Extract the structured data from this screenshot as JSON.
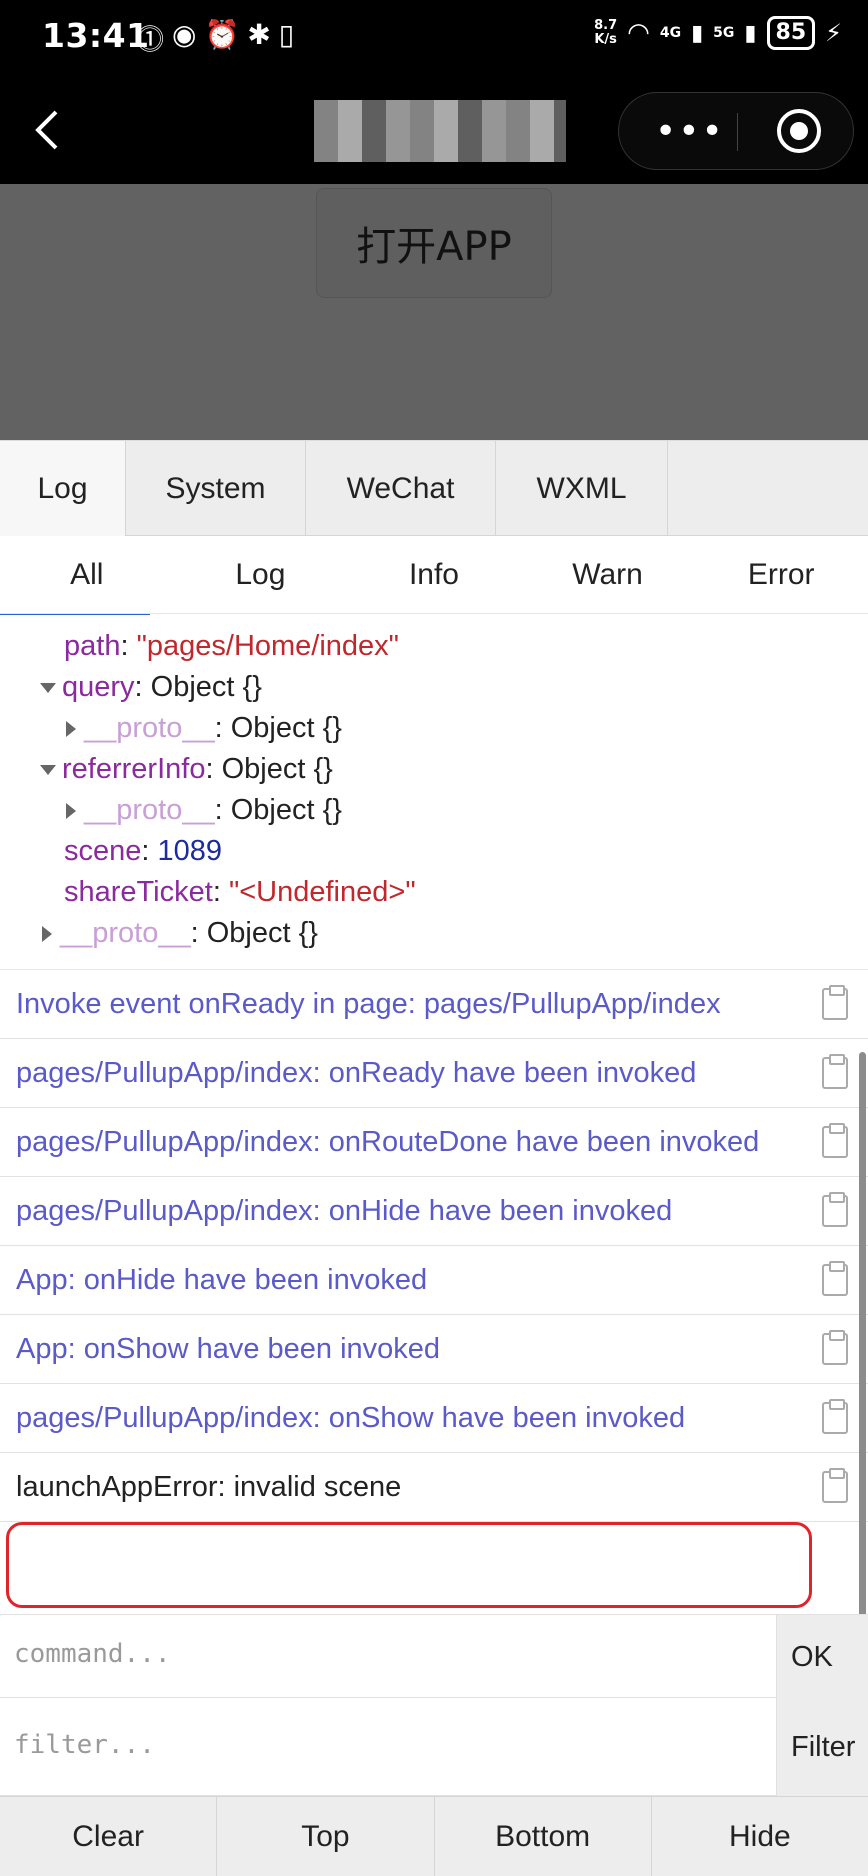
{
  "status_bar": {
    "time": "13:41",
    "net_speed_value": "8.7",
    "net_speed_unit": "K/s",
    "net_4g": "4G",
    "net_5g": "5G",
    "battery": "85",
    "left_icons": [
      "hd-icon",
      "eye-icon",
      "alarm-icon",
      "bluetooth-icon",
      "vibrate-icon"
    ]
  },
  "page": {
    "open_app_button": "打开APP"
  },
  "vconsole": {
    "tabs": [
      {
        "label": "Log"
      },
      {
        "label": "System"
      },
      {
        "label": "WeChat"
      },
      {
        "label": "WXML"
      }
    ],
    "subtabs": [
      {
        "label": "All"
      },
      {
        "label": "Log"
      },
      {
        "label": "Info"
      },
      {
        "label": "Warn"
      },
      {
        "label": "Error"
      }
    ],
    "tree": {
      "path_key": "path",
      "path_val": "\"pages/Home/index\"",
      "query_key": "query",
      "query_val": "Object {}",
      "proto_key": "__proto__",
      "proto_val": "Object {}",
      "referrer_key": "referrerInfo",
      "referrer_val": "Object {}",
      "scene_key": "scene",
      "scene_val": "1089",
      "share_key": "shareTicket",
      "share_val": "\"<Undefined>\"",
      "colon": ":"
    },
    "logs": [
      "Invoke event onReady in page: pages/PullupApp/index",
      "pages/PullupApp/index: onReady have been invoked",
      "pages/PullupApp/index: onRouteDone have been invoked",
      "pages/PullupApp/index: onHide have been invoked",
      "App: onHide have been invoked",
      "App: onShow have been invoked",
      "pages/PullupApp/index: onShow have been invoked",
      "launchAppError:  invalid scene"
    ],
    "command_placeholder": "command...",
    "command_button": "OK",
    "filter_placeholder": "filter...",
    "filter_button": "Filter",
    "toolbar": [
      {
        "label": "Clear"
      },
      {
        "label": "Top"
      },
      {
        "label": "Bottom"
      },
      {
        "label": "Hide"
      }
    ]
  }
}
